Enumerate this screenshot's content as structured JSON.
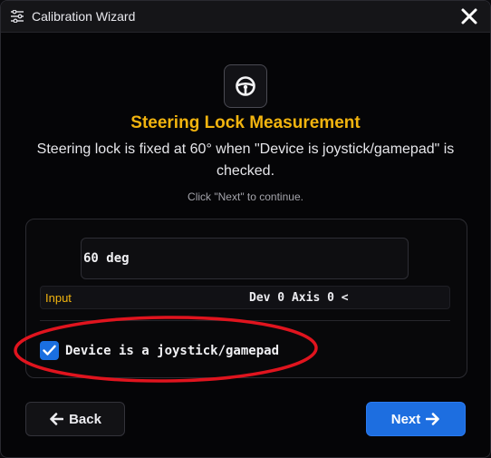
{
  "window": {
    "title": "Calibration Wizard",
    "title_icon": "sliders-icon",
    "close_icon": "close-icon"
  },
  "step": {
    "icon": "steering-wheel-icon",
    "heading": "Steering Lock Measurement",
    "description": "Steering lock is fixed at 60° when \"Device is joystick/gamepad\" is checked.",
    "hint": "Click \"Next\" to continue."
  },
  "measurement": {
    "value": "60 deg",
    "input_label": "Input",
    "input_value": "Dev 0 Axis 0 <"
  },
  "checkbox": {
    "label": "Device is a joystick/gamepad",
    "checked": true
  },
  "buttons": {
    "back_label": "Back",
    "back_icon": "arrow-left-icon",
    "next_label": "Next",
    "next_icon": "arrow-right-icon"
  },
  "colors": {
    "accent_yellow": "#f2b40f",
    "primary_blue": "#1d6ee0",
    "annotation_red": "#e0141e"
  }
}
